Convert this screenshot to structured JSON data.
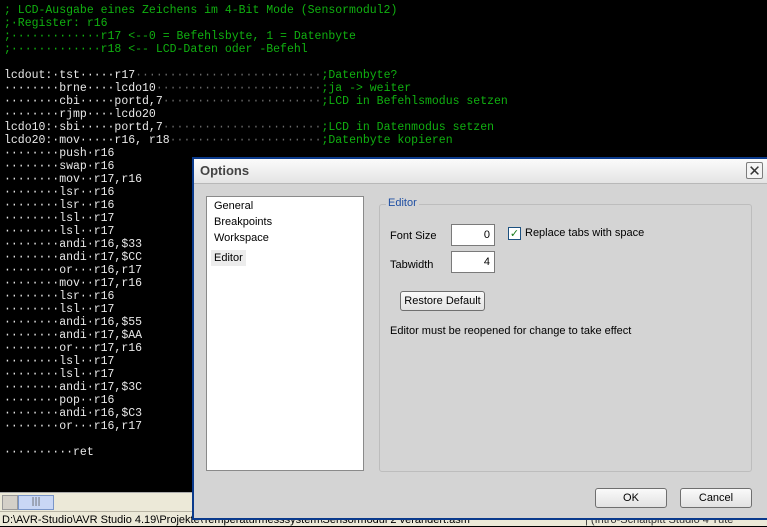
{
  "editor": {
    "lines": [
      [
        {
          "t": "; LCD-Ausgabe eines Zeichens im 4-Bit Mode (Sensormodul2)",
          "c": "g"
        }
      ],
      [
        {
          "t": ";·Register: r16",
          "c": "g"
        }
      ],
      [
        {
          "t": ";·············r17 <--0 = Befehlsbyte, 1 = Datenbyte",
          "c": "g"
        }
      ],
      [
        {
          "t": ";·············r18 <-- LCD-Daten oder -Befehl",
          "c": "g"
        }
      ],
      [],
      [
        {
          "t": "lcdout:·tst·····r17",
          "c": "w"
        },
        {
          "t": "···························",
          "c": "dot"
        },
        {
          "t": ";Datenbyte?",
          "c": "g"
        }
      ],
      [
        {
          "t": "········brne····lcdo10",
          "c": "w"
        },
        {
          "t": "························",
          "c": "dot"
        },
        {
          "t": ";ja -> weiter",
          "c": "g"
        }
      ],
      [
        {
          "t": "········cbi·····portd,7",
          "c": "w"
        },
        {
          "t": "·······················",
          "c": "dot"
        },
        {
          "t": ";LCD in Befehlsmodus setzen",
          "c": "g"
        }
      ],
      [
        {
          "t": "········rjmp····lcdo20",
          "c": "w"
        }
      ],
      [
        {
          "t": "lcdo10:·sbi·····portd,7",
          "c": "w"
        },
        {
          "t": "·······················",
          "c": "dot"
        },
        {
          "t": ";LCD in Datenmodus setzen",
          "c": "g"
        }
      ],
      [
        {
          "t": "lcdo20:·mov·····r16, r18",
          "c": "w"
        },
        {
          "t": "······················",
          "c": "dot"
        },
        {
          "t": ";Datenbyte kopieren",
          "c": "g"
        }
      ],
      [
        {
          "t": "········push·r16",
          "c": "w"
        }
      ],
      [
        {
          "t": "········swap·r16",
          "c": "w"
        }
      ],
      [
        {
          "t": "········mov··r17,r16",
          "c": "w"
        }
      ],
      [
        {
          "t": "········lsr··r16",
          "c": "w"
        }
      ],
      [
        {
          "t": "········lsr··r16",
          "c": "w"
        }
      ],
      [
        {
          "t": "········lsl··r17",
          "c": "w"
        }
      ],
      [
        {
          "t": "········lsl··r17",
          "c": "w"
        }
      ],
      [
        {
          "t": "········andi·r16,$33",
          "c": "w"
        }
      ],
      [
        {
          "t": "········andi·r17,$CC",
          "c": "w"
        }
      ],
      [
        {
          "t": "········or···r16,r17",
          "c": "w"
        }
      ],
      [
        {
          "t": "········mov··r17,r16",
          "c": "w"
        }
      ],
      [
        {
          "t": "········lsr··r16",
          "c": "w"
        }
      ],
      [
        {
          "t": "········lsl··r17",
          "c": "w"
        }
      ],
      [
        {
          "t": "········andi·r16,$55",
          "c": "w"
        }
      ],
      [
        {
          "t": "········andi·r17,$AA",
          "c": "w"
        }
      ],
      [
        {
          "t": "········or···r17,r16",
          "c": "w"
        }
      ],
      [
        {
          "t": "········lsl··r17",
          "c": "w"
        }
      ],
      [
        {
          "t": "········lsl··r17",
          "c": "w"
        }
      ],
      [
        {
          "t": "········andi·r17,$3C",
          "c": "w"
        }
      ],
      [
        {
          "t": "········pop··r16",
          "c": "w"
        }
      ],
      [
        {
          "t": "········andi·r16,$C3",
          "c": "w"
        }
      ],
      [
        {
          "t": "········or···r16,r17",
          "c": "w"
        }
      ],
      [],
      [
        {
          "t": "··········ret",
          "c": "w"
        }
      ]
    ]
  },
  "status": {
    "path": "D:\\AVR-Studio\\AVR Studio 4.19\\Projekte\\Temperaturmesssystem\\Sensormodul 2 verändert.asm *",
    "extra": "| (Intro-Schaltpltt Studio 4 Tute"
  },
  "dialog": {
    "title": "Options",
    "close_glyph": "✕",
    "categories": [
      "General",
      "Breakpoints",
      "Workspace",
      "Editor"
    ],
    "selected_category": "Editor",
    "group_title": "Editor",
    "font_size_label": "Font Size",
    "font_size_value": "0",
    "tabwidth_label": "Tabwidth",
    "tabwidth_value": "4",
    "replace_tabs_label": "Replace tabs with space",
    "replace_tabs_checked": true,
    "restore_default_label": "Restore Default",
    "note": "Editor must be reopened for change to take effect",
    "ok_label": "OK",
    "cancel_label": "Cancel"
  },
  "scrollbar": {
    "thumb_glyph": "|||"
  },
  "colors": {
    "code_comment": "#10b010",
    "code_text": "#e8e8e8",
    "dialog_border": "#0a3a8c"
  }
}
